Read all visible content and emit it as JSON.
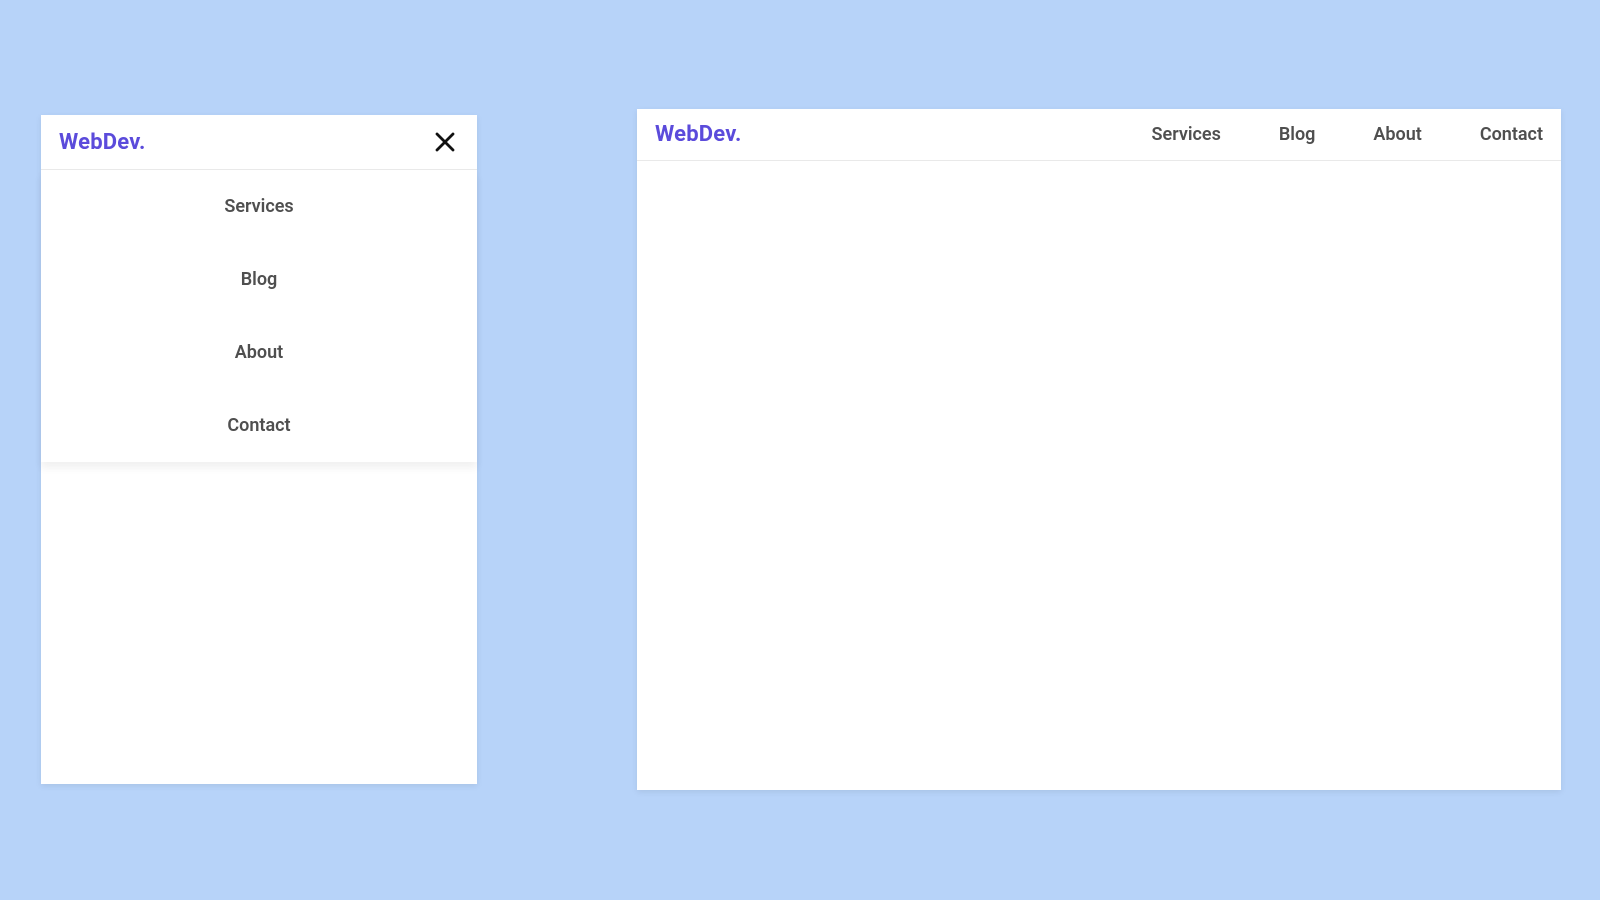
{
  "brand": "WebDev.",
  "nav_items": [
    {
      "label": "Services"
    },
    {
      "label": "Blog"
    },
    {
      "label": "About"
    },
    {
      "label": "Contact"
    }
  ],
  "colors": {
    "brand": "#5b4bdb",
    "bg": "#b7d3f9"
  }
}
